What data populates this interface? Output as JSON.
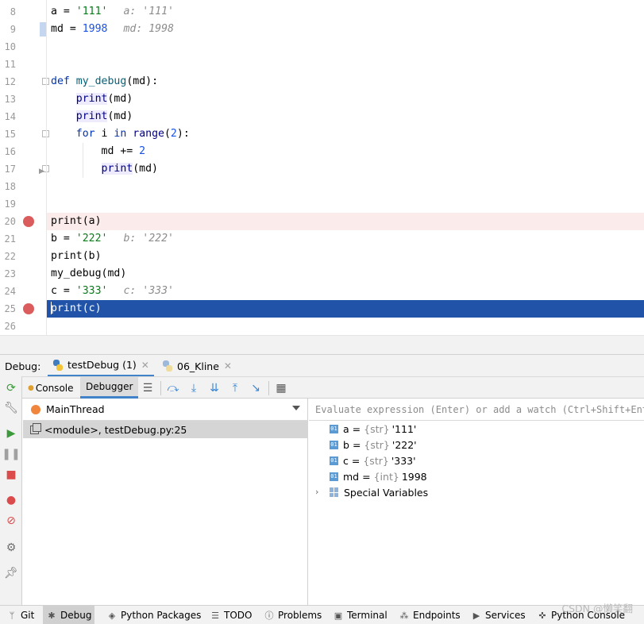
{
  "editor": {
    "lines": [
      {
        "num": "8"
      },
      {
        "num": "9"
      },
      {
        "num": "10"
      },
      {
        "num": "11"
      },
      {
        "num": "12"
      },
      {
        "num": "13"
      },
      {
        "num": "14"
      },
      {
        "num": "15"
      },
      {
        "num": "16"
      },
      {
        "num": "17"
      },
      {
        "num": "18"
      },
      {
        "num": "19"
      },
      {
        "num": "20"
      },
      {
        "num": "21"
      },
      {
        "num": "22"
      },
      {
        "num": "23"
      },
      {
        "num": "24"
      },
      {
        "num": "25"
      },
      {
        "num": "26"
      }
    ],
    "code": {
      "l8": {
        "pre": "a = ",
        "str": "'111'",
        "hint": "a: '111'"
      },
      "l9": {
        "pre": "md = ",
        "num": "1998",
        "hint": "md: 1998"
      },
      "l12": {
        "kw": "def",
        "fn": "my_debug",
        "rest": "(md):"
      },
      "l13": {
        "call": "print",
        "rest": "(md)"
      },
      "l14": {
        "call": "print",
        "rest": "(md)"
      },
      "l15": {
        "kw1": "for",
        "mid": " i ",
        "kw2": "in",
        "bi": "range",
        "open": "(",
        "num": "2",
        "close": "):"
      },
      "l16": {
        "pre": "md += ",
        "num": "2"
      },
      "l17": {
        "call": "print",
        "rest": "(md)"
      },
      "l20": {
        "text": "print(a)"
      },
      "l21": {
        "pre": "b = ",
        "str": "'222'",
        "hint": "b: '222'"
      },
      "l22": {
        "text": "print(b)"
      },
      "l23": {
        "text": "my_debug(md)"
      },
      "l24": {
        "pre": "c = ",
        "str": "'333'",
        "hint": "c: '333'"
      },
      "l25": {
        "text": "print(c)"
      }
    }
  },
  "debug": {
    "label": "Debug:",
    "run_tabs": [
      {
        "label": "testDebug (1)"
      },
      {
        "label": "06_Kline"
      }
    ],
    "tabs": [
      {
        "label": "Console"
      },
      {
        "label": "Debugger"
      }
    ],
    "thread": "MainThread",
    "frame": "<module>, testDebug.py:25",
    "eval_placeholder": "Evaluate expression (Enter) or add a watch (Ctrl+Shift+Enter)",
    "variables": [
      {
        "name": "a",
        "type": "{str}",
        "value": "'111'"
      },
      {
        "name": "b",
        "type": "{str}",
        "value": "'222'"
      },
      {
        "name": "c",
        "type": "{str}",
        "value": "'333'"
      },
      {
        "name": "md",
        "type": "{int}",
        "value": "1998"
      }
    ],
    "var_icon_text": "01",
    "special": "Special Variables"
  },
  "bottom_bar": {
    "items": [
      {
        "label": "Git",
        "icon": "branch-icon"
      },
      {
        "label": "Debug",
        "icon": "bug-icon"
      },
      {
        "label": "Python Packages",
        "icon": "layers-icon"
      },
      {
        "label": "TODO",
        "icon": "list-icon"
      },
      {
        "label": "Problems",
        "icon": "info-icon"
      },
      {
        "label": "Terminal",
        "icon": "terminal-icon"
      },
      {
        "label": "Endpoints",
        "icon": "endpoints-icon"
      },
      {
        "label": "Services",
        "icon": "services-icon"
      },
      {
        "label": "Python Console",
        "icon": "python-icon"
      }
    ]
  },
  "watermark": "CSDN @懒笑翻",
  "colors": {
    "breakpoint": "#db5c5c",
    "execution_line": "#2154a8",
    "breakpoint_line": "#fbeceb",
    "accent": "#4083c9"
  }
}
